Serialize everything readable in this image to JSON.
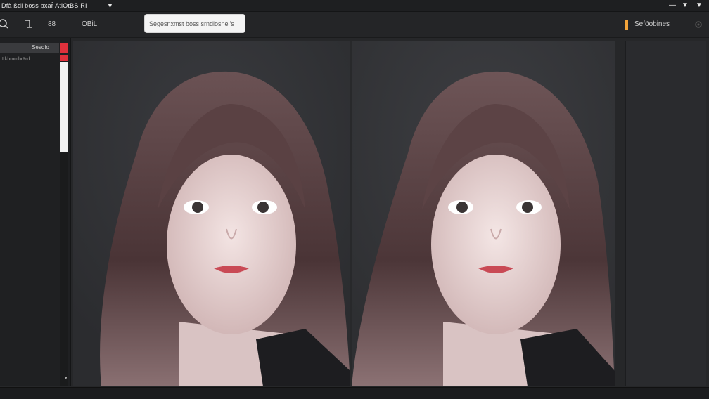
{
  "window": {
    "title": "Dfà ßdi boss  bxar̈  AtiOtBS  RI",
    "minimize_glyph": "—",
    "wifi_glyph": "▼"
  },
  "toolbar": {
    "tool_label": "OBiL",
    "grid_label": "88",
    "search": {
      "value": "Segesnxmst boss srndlosnel’s"
    },
    "right_label": "Seföobines"
  },
  "left_panel": {
    "header": "Sesdfo",
    "item": "Lkbmmbrärd"
  },
  "colors": {
    "accent_red": "#e0313c",
    "accent_orange": "#f2a33a",
    "background": "#262729"
  },
  "icons": {
    "search": "search-icon",
    "crop": "crop-icon",
    "grid": "grid-icon",
    "settings": "gear-icon"
  }
}
